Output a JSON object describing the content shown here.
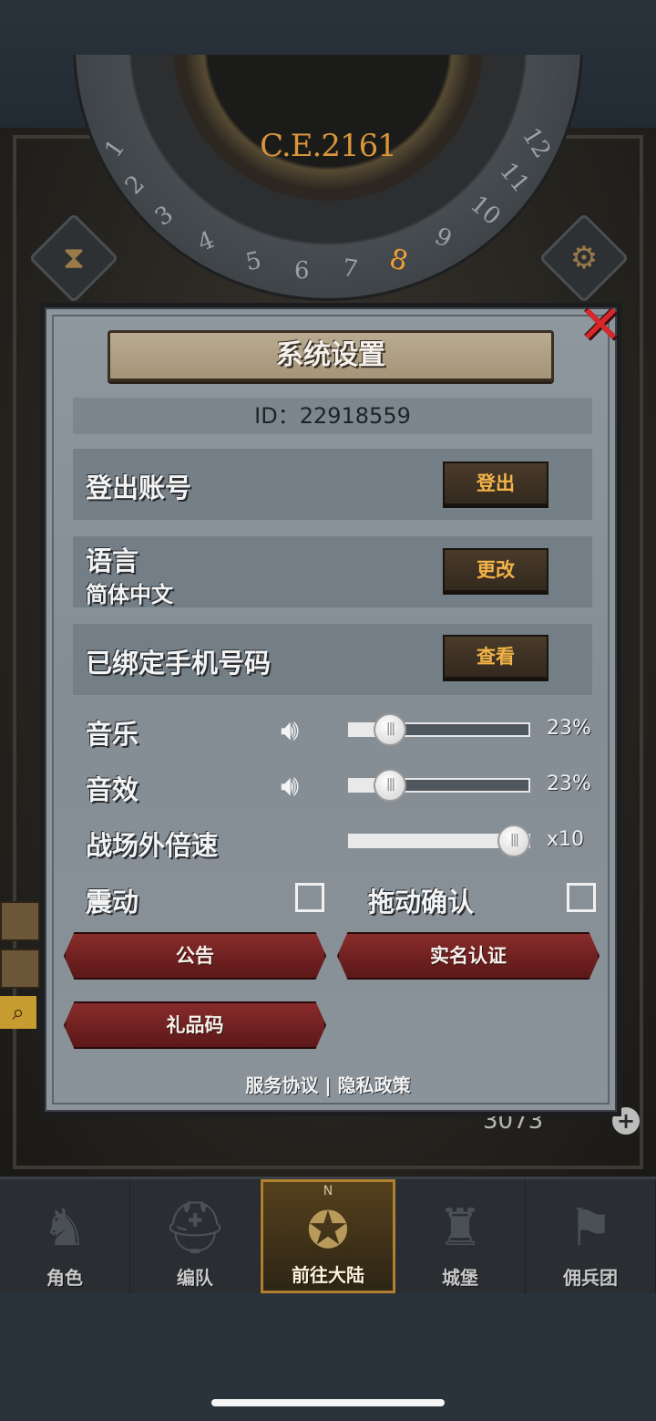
{
  "header": {
    "year": "C.E.2161",
    "dial_numbers": [
      "1",
      "2",
      "3",
      "4",
      "5",
      "6",
      "7",
      "8",
      "9",
      "10",
      "11",
      "12"
    ],
    "active_number": "8"
  },
  "panel": {
    "title": "系统设置",
    "id_text": "ID：22918559",
    "logout": {
      "label": "登出账号",
      "button": "登出"
    },
    "language": {
      "label": "语言",
      "value": "简体中文",
      "button": "更改"
    },
    "phone": {
      "label": "已绑定手机号码",
      "button": "查看"
    },
    "music": {
      "label": "音乐",
      "percent_text": "23%",
      "level": 0.23
    },
    "sfx": {
      "label": "音效",
      "percent_text": "23%",
      "level": 0.23
    },
    "speed": {
      "label": "战场外倍速",
      "value_text": "x10",
      "level": 1.0
    },
    "vibration": {
      "label": "震动",
      "checked": false
    },
    "drag_confirm": {
      "label": "拖动确认",
      "checked": false
    },
    "buttons": {
      "notice": "公告",
      "realname": "实名认证",
      "gift": "礼品码"
    },
    "links": {
      "terms": "服务协议",
      "separator": "|",
      "privacy": "隐私政策"
    },
    "close_icon": "close-x-icon"
  },
  "background": {
    "resource_value": "3073"
  },
  "nav": {
    "items": [
      {
        "label": "角色",
        "icon": "knight-icon"
      },
      {
        "label": "编队",
        "icon": "helmet-icon"
      },
      {
        "label": "前往大陆",
        "icon": "compass-icon",
        "active": true,
        "mark": "N"
      },
      {
        "label": "城堡",
        "icon": "castle-icon"
      },
      {
        "label": "佣兵团",
        "icon": "flag-icon"
      }
    ]
  },
  "colors": {
    "accent_gold": "#f2b448",
    "close_red": "#d8272a",
    "button_red": "#8a2c2c",
    "panel_gray": "#8c959c"
  }
}
